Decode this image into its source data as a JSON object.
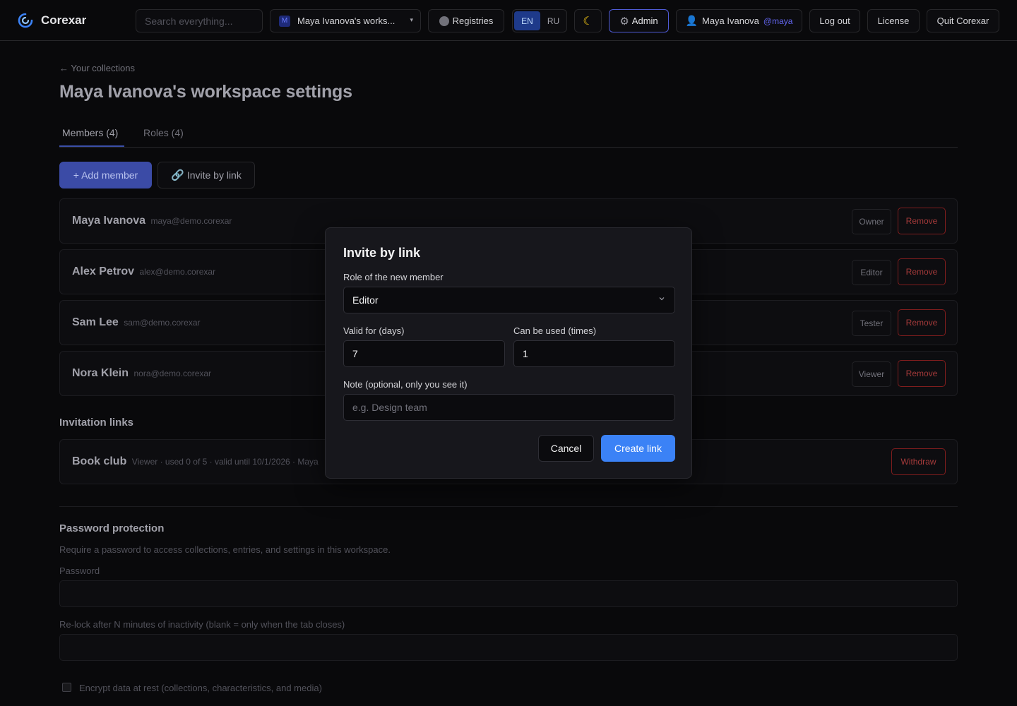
{
  "app": {
    "name": "Corexar",
    "colors": {
      "accent": "#3b82f6",
      "danger": "#7f1d1d",
      "admin_border": "#4f5bd5"
    }
  },
  "topbar": {
    "search_placeholder": "Search everything...",
    "workspace_badge": "M",
    "workspace_label": "Maya Ivanova's works...",
    "registries_label": "Registries",
    "lang_en": "EN",
    "lang_ru": "RU",
    "theme_icon": "moon-icon",
    "admin_label": "Admin",
    "user_name": "Maya Ivanova",
    "user_handle": "@maya",
    "logout_label": "Log out",
    "license_label": "License",
    "quit_label": "Quit Corexar"
  },
  "page": {
    "back_label": "Your collections",
    "title": "Maya Ivanova's workspace settings",
    "tabs": [
      {
        "label": "Members (4)",
        "active": true
      },
      {
        "label": "Roles (4)",
        "active": false
      }
    ],
    "add_member_label": "+ Add member",
    "invite_by_link_label": "Invite by link"
  },
  "members": [
    {
      "name": "Maya Ivanova",
      "email": "maya@demo.corexar",
      "role": "Owner",
      "action": "Remove"
    },
    {
      "name": "Alex Petrov",
      "email": "alex@demo.corexar",
      "role": "Editor",
      "action": "Remove"
    },
    {
      "name": "Sam Lee",
      "email": "sam@demo.corexar",
      "role": "Tester",
      "action": "Remove"
    },
    {
      "name": "Nora Klein",
      "email": "nora@demo.corexar",
      "role": "Viewer",
      "action": "Remove"
    }
  ],
  "invitations": {
    "heading": "Invitation links",
    "items": [
      {
        "name": "Book club",
        "meta": "Viewer · used 0 of 5 · valid until 10/1/2026 · Maya",
        "action": "Withdraw"
      }
    ]
  },
  "password": {
    "heading": "Password protection",
    "description": "Require a password to access collections, entries, and settings in this workspace.",
    "password_label": "Password",
    "password_value": "",
    "relock_label": "Re-lock after N minutes of inactivity (blank = only when the tab closes)",
    "relock_value": "",
    "encrypt_label": "Encrypt data at rest (collections, characteristics, and media)",
    "encrypt_checked": false
  },
  "modal": {
    "title": "Invite by link",
    "role_label": "Role of the new member",
    "role_value": "Editor",
    "valid_label": "Valid for (days)",
    "valid_value": "7",
    "uses_label": "Can be used (times)",
    "uses_value": "1",
    "note_label": "Note (optional, only you see it)",
    "note_value": "",
    "note_placeholder": "e.g. Design team",
    "cancel_label": "Cancel",
    "create_label": "Create link"
  }
}
